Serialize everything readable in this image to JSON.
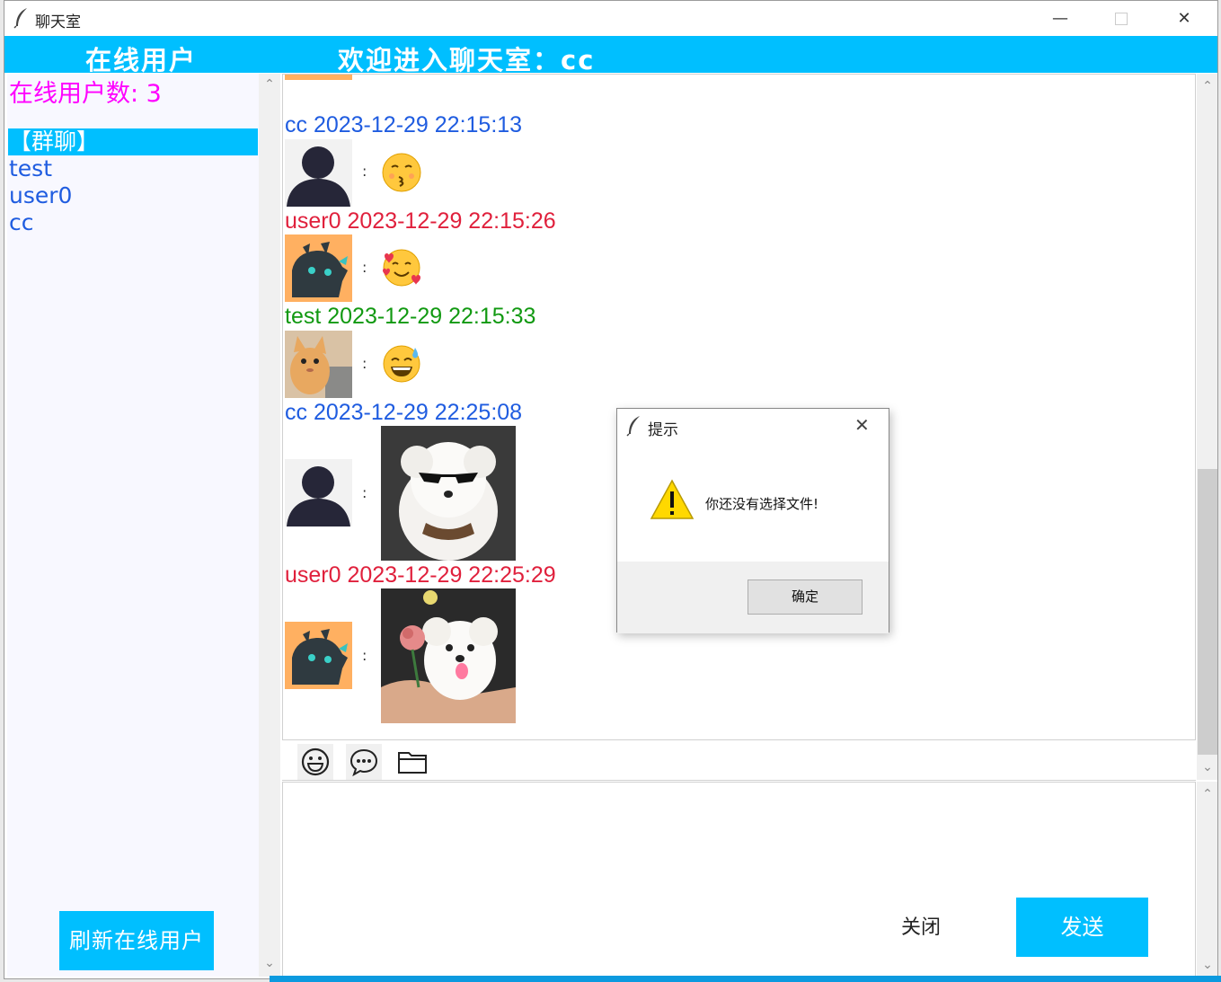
{
  "window": {
    "title": "聊天室",
    "minimize": "—",
    "close": "✕"
  },
  "header": {
    "online_users": "在线用户",
    "welcome": "欢迎进入聊天室：cc"
  },
  "sidebar": {
    "count_label": "在线用户数: 3",
    "users": [
      "【群聊】",
      "test",
      "user0",
      "cc"
    ],
    "selected": "【群聊】",
    "refresh_label": "刷新在线用户"
  },
  "messages": [
    {
      "sender": "cc 2023-12-29 22:15:13",
      "color": "#1f5ce0",
      "avatar": "silhouette-avatar",
      "content": "emoji-kiss"
    },
    {
      "sender": "user0 2023-12-29 22:15:26",
      "color": "#e0203c",
      "avatar": "dragon-avatar",
      "content": "emoji-hearts"
    },
    {
      "sender": "test 2023-12-29 22:15:33",
      "color": "#119911",
      "avatar": "cat-avatar",
      "content": "emoji-sweat"
    },
    {
      "sender": "cc 2023-12-29 22:25:08",
      "color": "#1f5ce0",
      "avatar": "silhouette-avatar",
      "content": "dog-sunglasses-photo"
    },
    {
      "sender": "user0 2023-12-29 22:25:29",
      "color": "#e0203c",
      "avatar": "dragon-avatar",
      "content": "dog-flower-photo"
    }
  ],
  "colon": ":",
  "toolbar": {
    "icons": [
      "smile-icon",
      "chat-bubble-icon",
      "folder-icon"
    ]
  },
  "buttons": {
    "close": "关闭",
    "send": "发送"
  },
  "dialog": {
    "title": "提示",
    "message": "你还没有选择文件!",
    "ok": "确定",
    "close": "✕"
  },
  "colors": {
    "accent": "#00bfff",
    "count": "#ff00ff"
  }
}
